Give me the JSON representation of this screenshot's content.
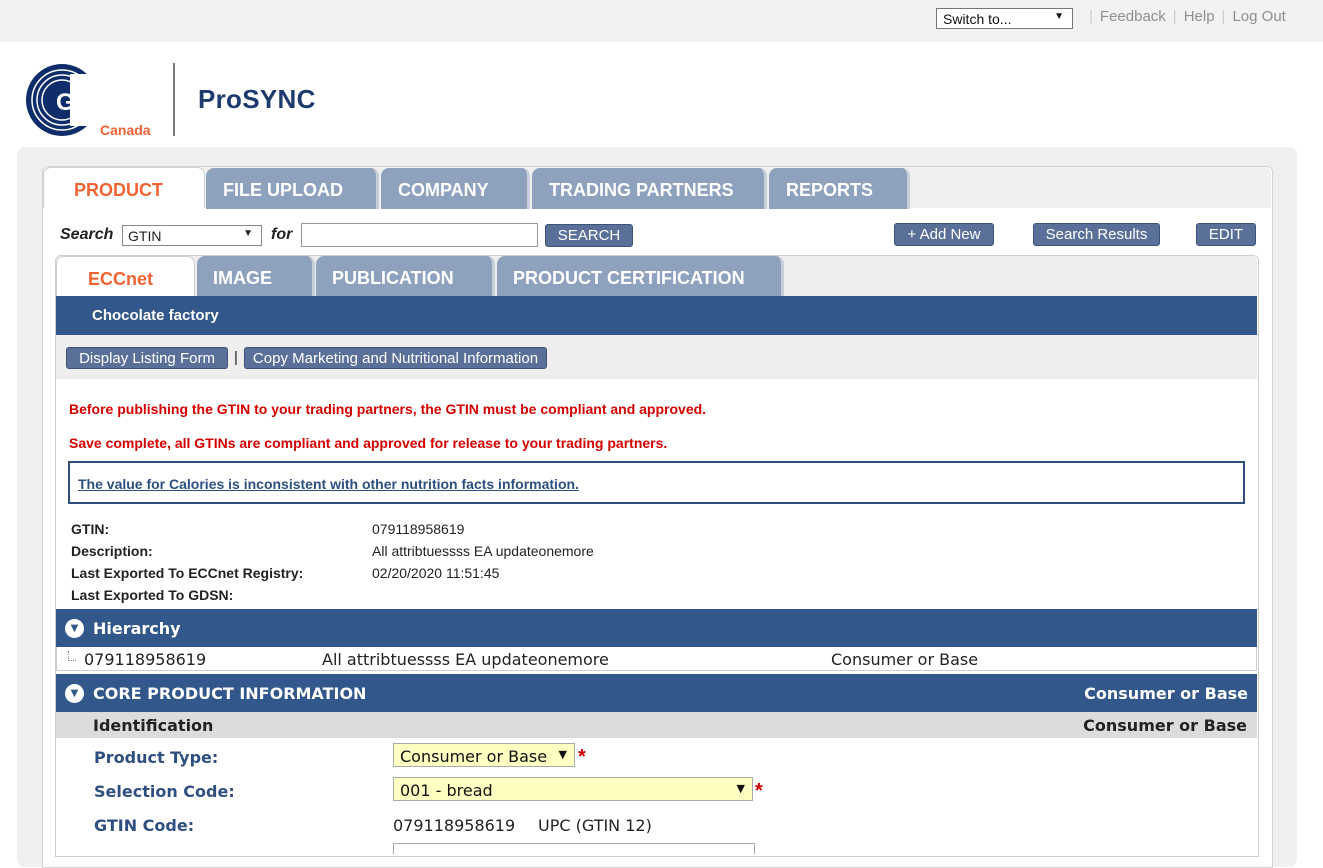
{
  "topbar": {
    "switch_to": "Switch to...",
    "feedback": "Feedback",
    "help": "Help",
    "logout": "Log Out"
  },
  "brand": {
    "logo_text": "GS1",
    "logo_sub": "Canada",
    "app_name": "ProSYNC"
  },
  "main_tabs": [
    "PRODUCT",
    "FILE UPLOAD",
    "COMPANY",
    "TRADING PARTNERS",
    "REPORTS"
  ],
  "search": {
    "label": "Search",
    "field": "GTIN",
    "for_label": "for",
    "value": "",
    "button": "SEARCH"
  },
  "actions": {
    "add_new": "+ Add New",
    "search_results": "Search Results",
    "edit": "EDIT"
  },
  "sub_tabs": [
    "ECCnet",
    "IMAGE",
    "PUBLICATION",
    "PRODUCT CERTIFICATION"
  ],
  "company_name": "Chocolate factory",
  "listing_actions": {
    "display_listing": "Display Listing Form",
    "separator": "|",
    "copy_marketing": "Copy Marketing and Nutritional Information"
  },
  "messages": {
    "publish_notice": "Before publishing the GTIN to your trading partners, the GTIN must be compliant and approved.",
    "save_complete": "Save complete, all GTINs are compliant and approved for release to your trading partners.",
    "warning_link": "The value for Calories is inconsistent with other nutrition facts information."
  },
  "product_info": [
    {
      "label": "GTIN:",
      "value": "079118958619"
    },
    {
      "label": "Description:",
      "value": "All attribtuessss EA updateonemore"
    },
    {
      "label": "Last Exported To ECCnet Registry:",
      "value": "02/20/2020 11:51:45"
    },
    {
      "label": "Last Exported To GDSN:",
      "value": ""
    }
  ],
  "hierarchy": {
    "title": "Hierarchy",
    "row": {
      "gtin": "079118958619",
      "description": "All attribtuessss EA updateonemore",
      "level": "Consumer or Base"
    }
  },
  "core_section": {
    "title": "CORE PRODUCT INFORMATION",
    "level": "Consumer or Base",
    "subsection": "Identification",
    "subsection_level": "Consumer or Base"
  },
  "fields": {
    "product_type": {
      "label": "Product Type:",
      "value": "Consumer or Base"
    },
    "selection_code": {
      "label": "Selection Code:",
      "value": "001 - bread"
    },
    "gtin_code": {
      "label": "GTIN Code:",
      "value": "079118958619",
      "type": "UPC (GTIN 12)"
    },
    "required_marker": "*"
  },
  "colors": {
    "brand_blue": "#32578a",
    "tab_blue": "#8fa2bd",
    "accent_orange": "#f26334",
    "error_red": "#d40000",
    "required_field_bg": "#ffffc2"
  }
}
